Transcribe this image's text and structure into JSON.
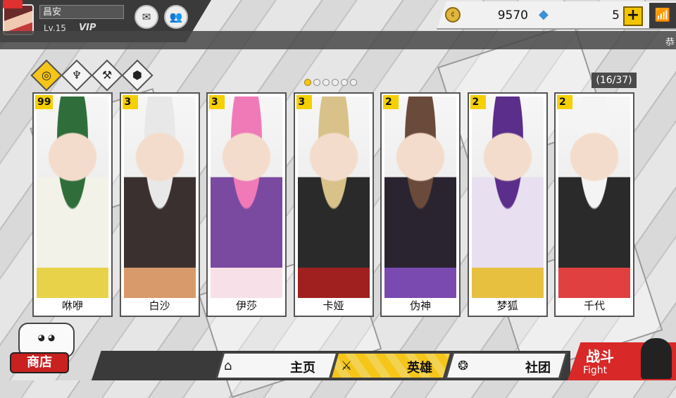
{
  "player": {
    "name": "昌安",
    "level": "Lv.15",
    "vip": "VIP"
  },
  "resources": {
    "gold": "9570",
    "diamonds": "5"
  },
  "marquee": "恭",
  "filters": [
    {
      "name": "all",
      "icon": "◎",
      "selected": true
    },
    {
      "name": "tank",
      "icon": "♆",
      "selected": false
    },
    {
      "name": "attack",
      "icon": "⚒",
      "selected": false
    },
    {
      "name": "support",
      "icon": "⬢",
      "selected": false
    }
  ],
  "page_dots": {
    "total": 6,
    "active": 0
  },
  "hero_count": "(16/37)",
  "heroes": [
    {
      "name": "咻咿",
      "level": "99",
      "colors": [
        "#2f6e3a",
        "#f2f2e8",
        "#e8d24a"
      ]
    },
    {
      "name": "白沙",
      "level": "3",
      "colors": [
        "#e8e8e8",
        "#3b3030",
        "#d89a6a"
      ]
    },
    {
      "name": "伊莎",
      "level": "3",
      "colors": [
        "#f07ab8",
        "#7a4aa0",
        "#f8e0e8"
      ]
    },
    {
      "name": "卡娅",
      "level": "3",
      "colors": [
        "#d8c28a",
        "#2a2a2a",
        "#a02020"
      ]
    },
    {
      "name": "伪神",
      "level": "2",
      "colors": [
        "#6a4a3a",
        "#2a2430",
        "#7a4ab0"
      ]
    },
    {
      "name": "梦狐",
      "level": "2",
      "colors": [
        "#5a2e8a",
        "#e8e0f0",
        "#e8c040"
      ]
    },
    {
      "name": "千代",
      "level": "2",
      "colors": [
        "#f4f4f4",
        "#2a2a2a",
        "#e04040"
      ]
    }
  ],
  "nav": {
    "home": "主页",
    "heroes": "英雄",
    "guild": "社团",
    "active": "heroes"
  },
  "shop": {
    "label": "商店"
  },
  "fight": {
    "label_cn": "战斗",
    "label_en": "Fight"
  }
}
